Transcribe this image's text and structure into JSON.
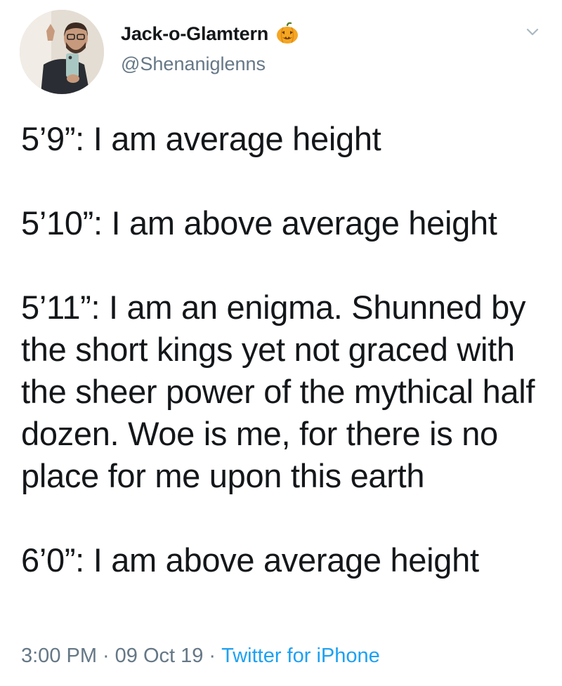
{
  "author": {
    "display_name": "Jack-o-Glamtern",
    "name_emoji": "jack-o-lantern-icon",
    "handle": "@Shenaniglenns"
  },
  "tweet": {
    "paragraphs": [
      "5’9”: I am average height",
      "5’10”: I am above average height",
      "5’11”: I am an enigma. Shunned by the short kings yet not graced with the sheer power of the mythical half dozen. Woe is me, for there is no place for me upon this earth",
      "6’0”: I am above average height"
    ]
  },
  "meta": {
    "time": "3:00 PM",
    "separator": "·",
    "date": "09 Oct 19",
    "source": "Twitter for iPhone"
  },
  "colors": {
    "text": "#14171a",
    "secondary": "#657786",
    "link": "#1da1f2"
  }
}
